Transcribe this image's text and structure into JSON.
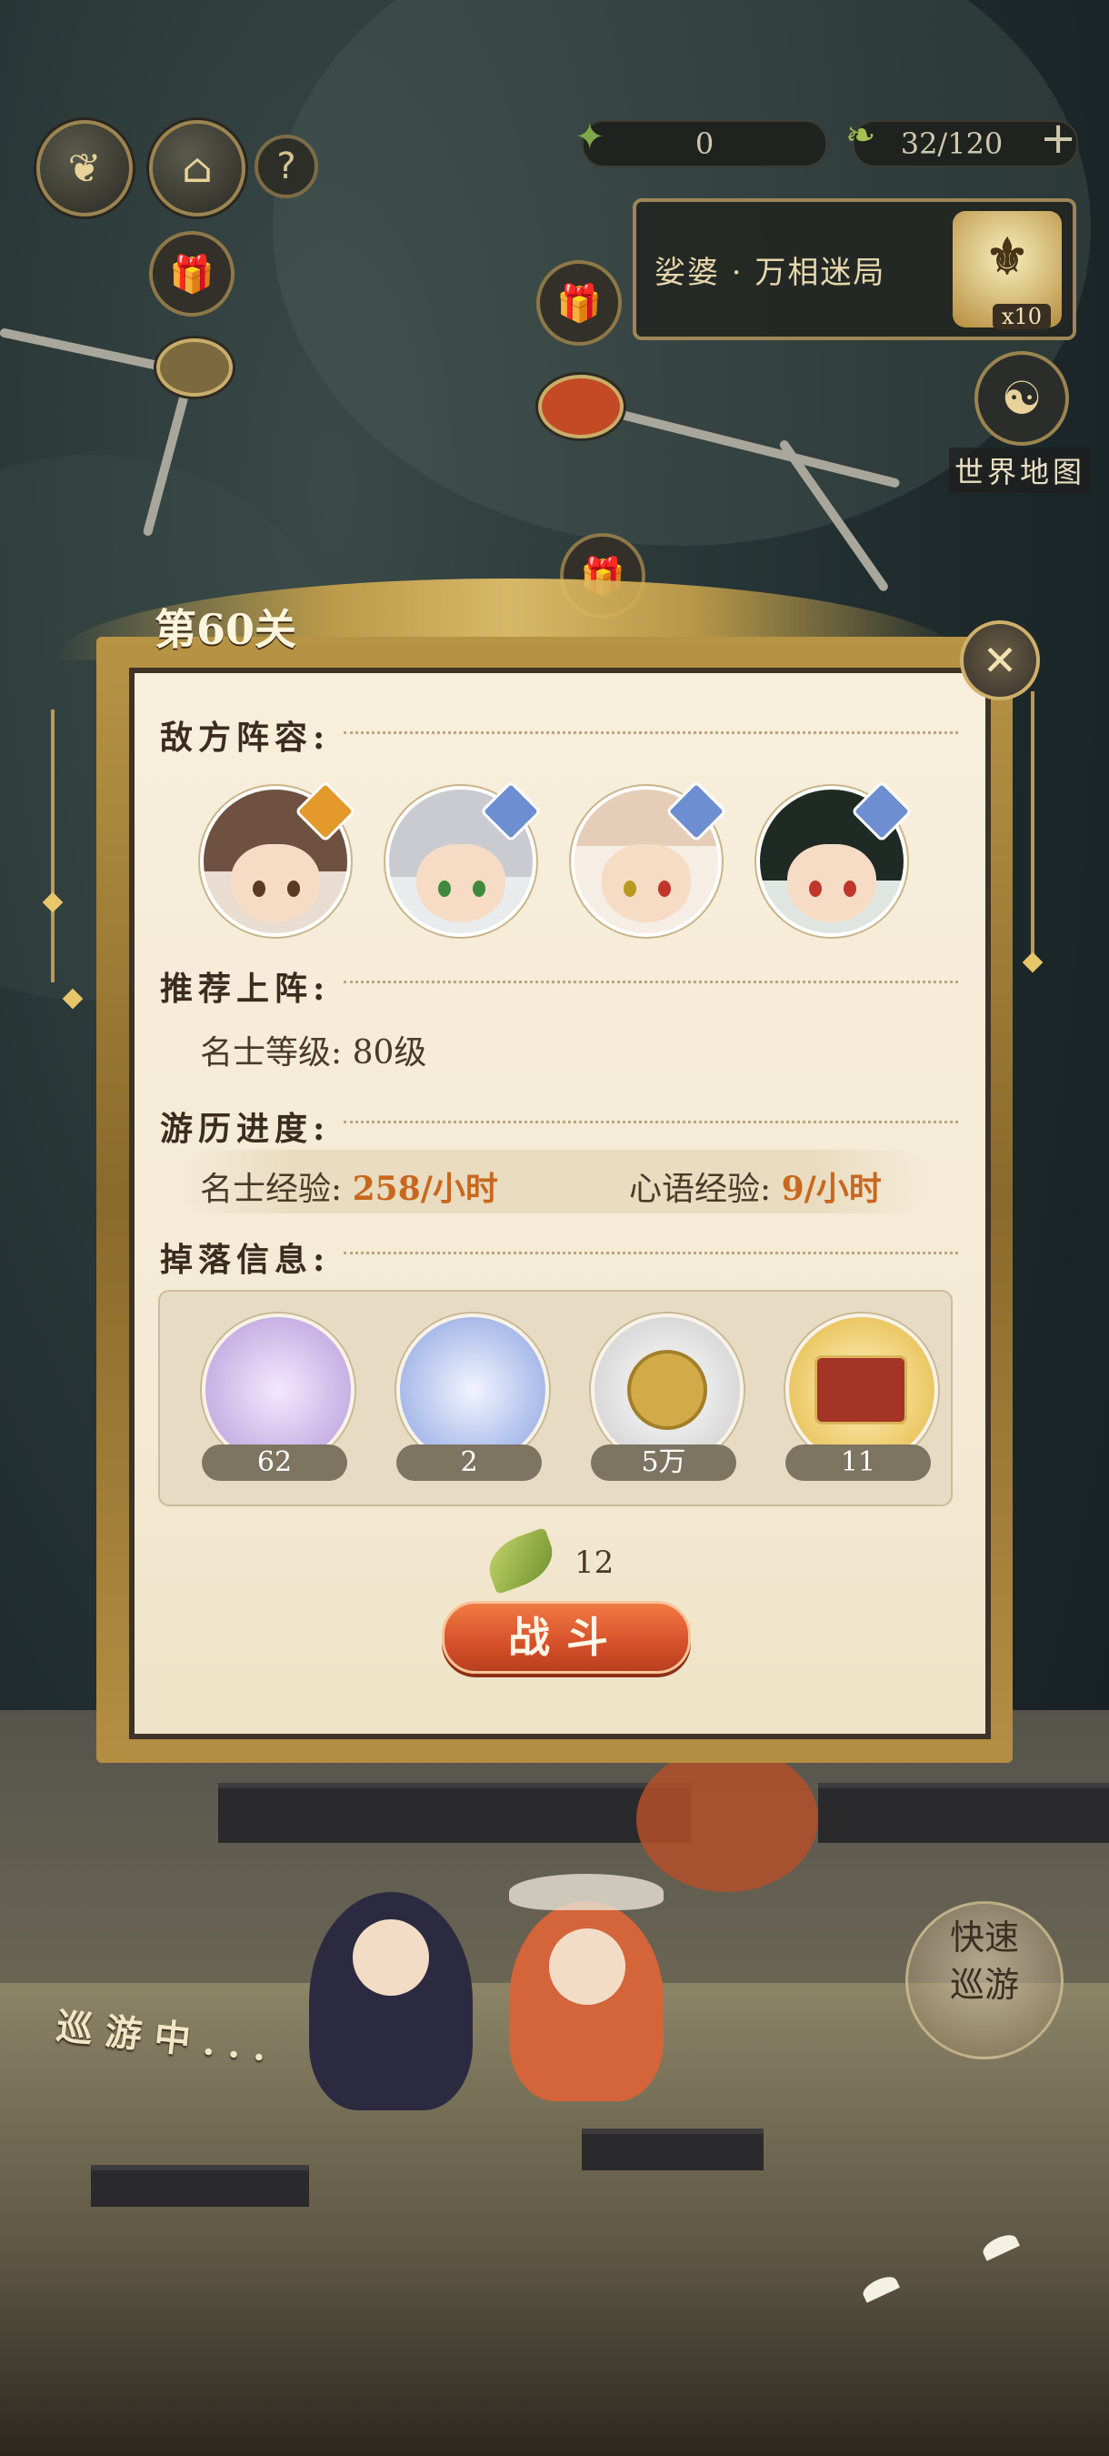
{
  "hud": {
    "resource_a_value": "0",
    "resource_b_value": "32/120",
    "add_label": "+",
    "help_label": "?"
  },
  "stage_panel": {
    "title": "娑婆 · 万相迷局",
    "badge_count": "x10"
  },
  "world_map": {
    "label": "世界地图"
  },
  "dialog": {
    "level_title": "第60关",
    "close_label": "✕",
    "enemy_lineup_label": "敌方阵容:",
    "recommend_label": "推荐上阵:",
    "recommend_value": "名士等级: 80级",
    "progress_label": "游历进度:",
    "exp_mingshi_label": "名士经验:",
    "exp_mingshi_value": "258/小时",
    "exp_xinyu_label": "心语经验:",
    "exp_xinyu_value": "9/小时",
    "drop_label": "掉落信息:",
    "drops": [
      {
        "count": "62"
      },
      {
        "count": "2"
      },
      {
        "count": "5万"
      },
      {
        "count": "11"
      }
    ],
    "cost_value": "12",
    "battle_label": "战斗"
  },
  "bottom": {
    "quick_tour_label": "快速巡游",
    "touring_label": "巡游中..."
  },
  "colors": {
    "accent_gold": "#c9ad6a",
    "battle_orange": "#d6502a",
    "exp_orange": "#c8681e"
  }
}
